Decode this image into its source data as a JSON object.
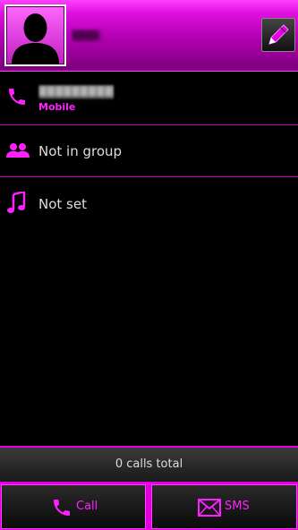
{
  "header": {
    "contact_name": "████",
    "photo_icon": "contact-silhouette-icon",
    "edit_icon": "edit-pencil-icon"
  },
  "details": {
    "phone": {
      "icon": "phone-icon",
      "number": "██████████",
      "type": "Mobile"
    },
    "group": {
      "icon": "group-icon",
      "label": "Not in group"
    },
    "ringtone": {
      "icon": "music-note-icon",
      "label": "Not set"
    }
  },
  "footer": {
    "calls_total": "0 calls total"
  },
  "actions": {
    "call_label": "Call",
    "call_icon": "phone-icon",
    "sms_label": "SMS",
    "sms_icon": "envelope-icon"
  },
  "colors": {
    "accent": "#ff20ff",
    "header_top": "#ff40ff",
    "header_bottom": "#7a007a",
    "background": "#000000"
  }
}
